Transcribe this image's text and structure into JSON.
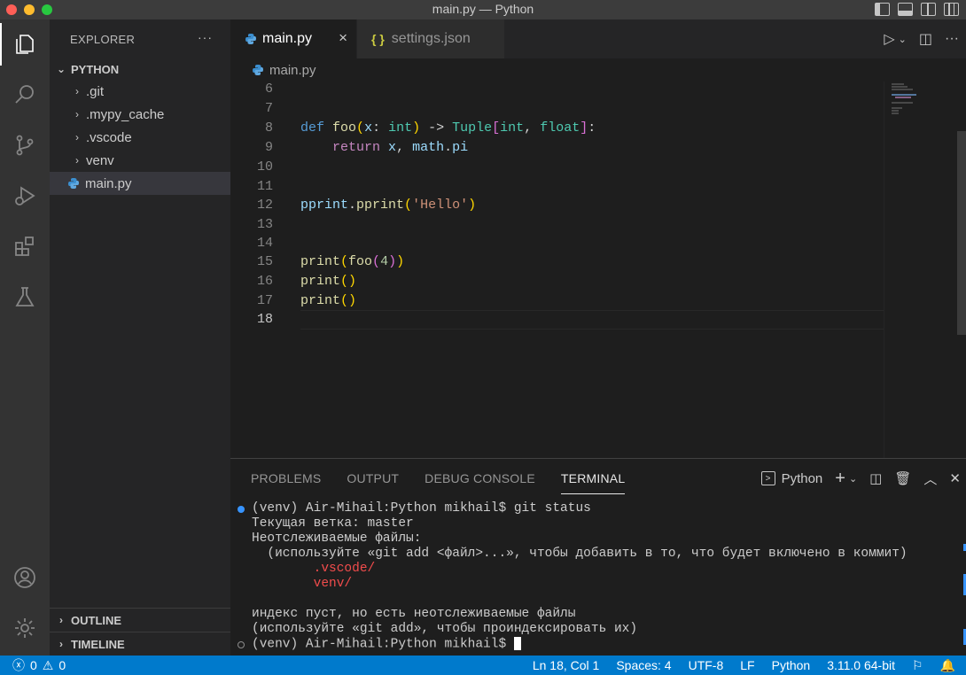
{
  "window": {
    "title": "main.py — Python"
  },
  "activity_bar": {
    "icons": [
      "explorer-icon",
      "search-icon",
      "source-control-icon",
      "run-debug-icon",
      "extensions-icon",
      "testing-icon",
      "account-icon",
      "settings-gear-icon"
    ]
  },
  "sidebar": {
    "title": "EXPLORER",
    "more": "···",
    "root": "PYTHON",
    "items": [
      {
        "label": ".git",
        "type": "folder"
      },
      {
        "label": ".mypy_cache",
        "type": "folder"
      },
      {
        "label": ".vscode",
        "type": "folder"
      },
      {
        "label": "venv",
        "type": "folder"
      },
      {
        "label": "main.py",
        "type": "python-file"
      }
    ],
    "outline": "OUTLINE",
    "timeline": "TIMELINE"
  },
  "tabs": [
    {
      "label": "main.py",
      "active": true,
      "close": "×"
    },
    {
      "label": "settings.json",
      "active": false,
      "icon_text": "{ }"
    }
  ],
  "breadcrumb": {
    "file": "main.py"
  },
  "editor": {
    "line_numbers": [
      "6",
      "7",
      "8",
      "9",
      "10",
      "11",
      "12",
      "13",
      "14",
      "15",
      "16",
      "17",
      "18"
    ],
    "current_line": "18"
  },
  "panel": {
    "tabs": [
      "PROBLEMS",
      "OUTPUT",
      "DEBUG CONSOLE",
      "TERMINAL"
    ],
    "active_tab": "TERMINAL",
    "terminal_name": "Python",
    "lines": {
      "l1": "(venv) Air-Mihail:Python mikhail$ git status",
      "l2": "Текущая ветка: master",
      "l3": "Неотслеживаемые файлы:",
      "l4": "  (используйте «git add <файл>...», чтобы добавить в то, что будет включено в коммит)",
      "l5": "        .vscode/",
      "l6": "        venv/",
      "l7": "",
      "l8": "индекс пуст, но есть неотслеживаемые файлы",
      "l9": "(используйте «git add», чтобы проиндексировать их)",
      "l10": "(venv) Air-Mihail:Python mikhail$ "
    }
  },
  "status_bar": {
    "errors": "0",
    "warnings": "0",
    "position": "Ln 18, Col 1",
    "spaces": "Spaces: 4",
    "encoding": "UTF-8",
    "eol": "LF",
    "language": "Python",
    "interpreter": "3.11.0 64-bit"
  },
  "colors": {
    "accent": "#007acc",
    "activity_bar": "#333333",
    "sidebar": "#252526",
    "editor": "#1e1e1e",
    "terminal_untracked": "#f14c4c"
  }
}
